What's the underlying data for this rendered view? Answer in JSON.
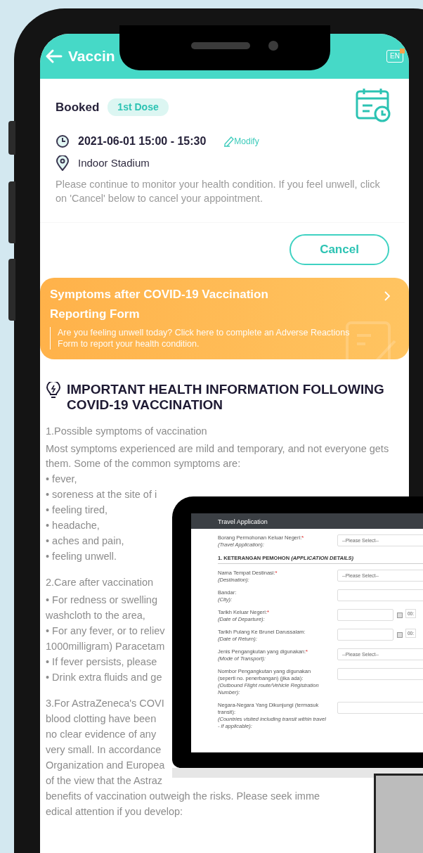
{
  "header": {
    "title": "Vaccin",
    "language": "EN"
  },
  "appointment": {
    "status": "Booked",
    "dose": "1st Dose",
    "datetime": "2021-06-01 15:00 - 15:30",
    "modify": "Modify",
    "location": "Indoor Stadium",
    "notice": "Please continue to monitor your health condition. If you feel unwell, click on 'Cancel' below to cancel your appointment.",
    "cancel": "Cancel"
  },
  "report_banner": {
    "title": "Symptoms after COVID-19 Vaccination Reporting Form",
    "description": "Are you feeling unwell today? Click here to complete an Adverse Reactions Form to report your health condition."
  },
  "health_info": {
    "heading": "IMPORTANT HEALTH INFORMATION FOLLOWING COVID-19 VACCINATION",
    "sections": [
      {
        "title": "1.Possible symptoms of vaccination",
        "lines": [
          "Most symptoms experienced are mild and temporary, and not everyone gets them. Some of the common symptoms are:",
          "• fever,",
          "• soreness at the site of i",
          "• feeling tired,",
          "• headache,",
          "• aches and pain,",
          "• feeling unwell."
        ]
      },
      {
        "title": "2.Care after vaccination",
        "lines": [
          "• For redness or swelling",
          "washcloth to the area,",
          "• For any fever, or to reliev",
          "1000milligram) Paracetam",
          "• If fever persists, please",
          "• Drink extra fluids and ge"
        ]
      },
      {
        "lines": [
          "3.For AstraZeneca's COVI",
          "blood clotting have been",
          "no clear evidence of any",
          "very small. In accordance",
          "Organization and Europea",
          "of the view that the Astraz",
          "benefits of vaccination outweigh the risks. Please seek imme",
          "edical attention if you develop:"
        ]
      }
    ]
  },
  "monitor": {
    "title": "Travel Application",
    "rows": [
      {
        "kind": "select",
        "label": "Borang Permohonan Keluar Negeri:",
        "required_mark": "*",
        "hint": "(Travel Application):",
        "value": "--Please Select--"
      },
      {
        "kind": "heading",
        "text": "1. KETERANGAN PEMOHON *(APPLICATION DETAILS)*"
      },
      {
        "kind": "select",
        "label": "Nama Tempat Destinasi:",
        "required_mark": "*",
        "hint": "(Destination):",
        "value": "--Please Select--"
      },
      {
        "kind": "text",
        "label": "Bandar:",
        "hint": "(City):"
      },
      {
        "kind": "date",
        "label": "Tarikh Keluar Negeri:",
        "required_mark": "*",
        "hint": "(Date of Departure):",
        "time": "00:"
      },
      {
        "kind": "date",
        "label": "Tarikh Pulang Ke Brunei Darussalam:",
        "hint": "(Date of Return):",
        "time": "00:"
      },
      {
        "kind": "select",
        "label": "Jenis Pengangkutan yang digunakan:",
        "required_mark": "*",
        "hint": "(Mode of Transport):",
        "value": "--Please Select--"
      },
      {
        "kind": "text",
        "label": "Nombor Pengangkutan yang digunakan (seperti no. penerbangan) (jika ada):",
        "hint": "(Outbound Flight route/Vehicle Registration Number):"
      },
      {
        "kind": "text",
        "label": "Negara-Negara Yang Dikunjungi (termasuk transit):",
        "hint": "(Countries visited including transit within travel - if applicable):"
      }
    ]
  }
}
